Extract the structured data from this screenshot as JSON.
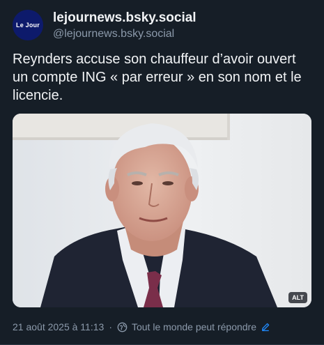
{
  "author": {
    "avatar_text": "Le Jour",
    "display_name": "lejournews.bsky.social",
    "handle": "@lejournews.bsky.social"
  },
  "post": {
    "text": "Reynders accuse son chauffeur d’avoir ouvert un compte ING « par erreur » en son nom et le licencie.",
    "image_alt_badge": "ALT",
    "timestamp": "21 août 2025 à 11:13",
    "separator": "·",
    "reply_setting": "Tout le monde peut répondre"
  },
  "colors": {
    "background": "#161e27",
    "text": "#f1f3f5",
    "muted": "#8c9aab",
    "accent": "#208bfe",
    "avatar_bg": "#0d1a6b"
  },
  "icons": {
    "reply_setting": "globe-icon",
    "edit": "pencil-icon"
  }
}
